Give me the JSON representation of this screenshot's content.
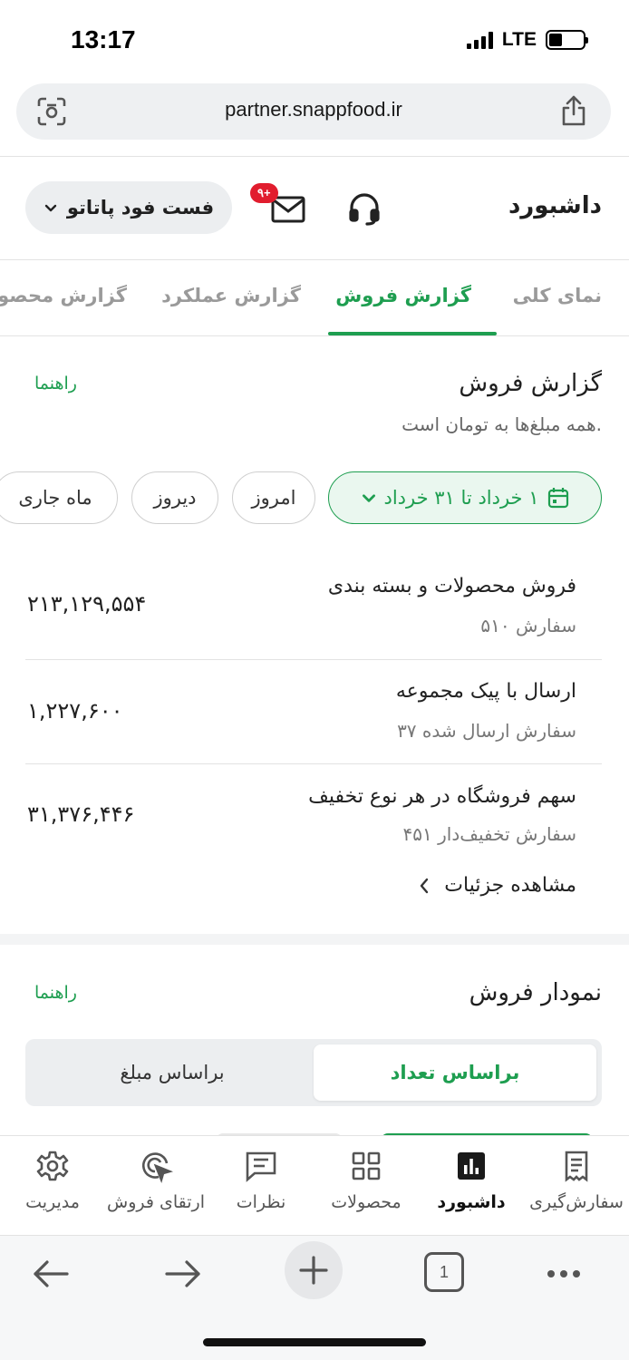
{
  "status_bar": {
    "time": "13:17",
    "network": "LTE",
    "battery_level": 0.38
  },
  "browser": {
    "url": "partner.snappfood.ir",
    "tab_count": "1"
  },
  "header": {
    "title": "داشبورد",
    "notification_badge": "۹+",
    "vendor_name": "فست فود پاتاتو"
  },
  "tabs": [
    {
      "label": "نمای کلی",
      "active": false
    },
    {
      "label": "گزارش فروش",
      "active": true
    },
    {
      "label": "گزارش عملکرد",
      "active": false
    },
    {
      "label": "گزارش محصولات",
      "active": false
    }
  ],
  "sales_report": {
    "title": "گزارش فروش",
    "guide": "راهنما",
    "subtitle": "همه مبلغ‌ها به تومان است.",
    "filters": {
      "date_range": "۱ خرداد تا ۳۱ خرداد",
      "today": "امروز",
      "yesterday": "دیروز",
      "current_month": "ماه جاری"
    },
    "rows": [
      {
        "title": "فروش محصولات و بسته بندی",
        "sub": "۵۱۰ سفارش",
        "value": "۲۱۳,۱۲۹,۵۵۴"
      },
      {
        "title": "ارسال با پیک مجموعه",
        "sub": "۳۷ سفارش ارسال شده",
        "value": "۱,۲۲۷,۶۰۰"
      },
      {
        "title": "سهم فروشگاه در هر نوع تخفیف",
        "sub": "۴۵۱ سفارش تخفیف‌دار",
        "value": "۳۱,۳۷۶,۴۴۶"
      }
    ],
    "details_link": "مشاهده جزئیات"
  },
  "sales_chart": {
    "title": "نمودار فروش",
    "guide": "راهنما",
    "toggle_count": "براساس تعداد",
    "toggle_amount": "براساس مبلغ"
  },
  "bottom_nav": [
    {
      "label": "سفارش‌گیری",
      "icon": "receipt-icon"
    },
    {
      "label": "داشبورد",
      "icon": "bar-chart-icon",
      "active": true
    },
    {
      "label": "محصولات",
      "icon": "grid-icon"
    },
    {
      "label": "نظرات",
      "icon": "comment-icon"
    },
    {
      "label": "ارتقای فروش",
      "icon": "target-icon"
    },
    {
      "label": "مدیریت",
      "icon": "gear-icon"
    }
  ]
}
